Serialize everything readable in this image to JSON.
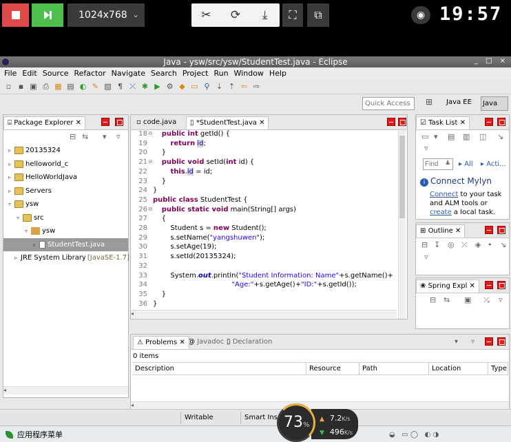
{
  "remote": {
    "resolution": "1024x768",
    "clock": "19:57"
  },
  "window": {
    "title": "Java - ysw/src/ysw/StudentTest.java - Eclipse"
  },
  "menu": [
    "File",
    "Edit",
    "Source",
    "Refactor",
    "Navigate",
    "Search",
    "Project",
    "Run",
    "Window",
    "Help"
  ],
  "toolbar": {
    "quick_access_placeholder": "Quick Access",
    "perspective_javaee": "Java EE",
    "perspective_java": "Java"
  },
  "package_explorer": {
    "title": "Package Explorer",
    "items": [
      {
        "label": "20135324",
        "depth": 0,
        "expanded": false,
        "icon": "project-folder"
      },
      {
        "label": "helloworld_c",
        "depth": 0,
        "expanded": false,
        "icon": "project-folder"
      },
      {
        "label": "HelloWorldJava",
        "depth": 0,
        "expanded": false,
        "icon": "project-folder"
      },
      {
        "label": "Servers",
        "depth": 0,
        "expanded": false,
        "icon": "project-folder"
      },
      {
        "label": "ysw",
        "depth": 0,
        "expanded": true,
        "icon": "project-folder"
      },
      {
        "label": "src",
        "depth": 1,
        "expanded": true,
        "icon": "source-folder"
      },
      {
        "label": "ysw",
        "depth": 2,
        "expanded": true,
        "icon": "package"
      },
      {
        "label": "StudentTest.java",
        "depth": 3,
        "expanded": false,
        "icon": "java-file",
        "selected": true
      },
      {
        "label": "JRE System Library",
        "suffix": "[JavaSE-1.7]",
        "depth": 1,
        "expanded": false,
        "icon": "library"
      }
    ]
  },
  "editor": {
    "tabs": [
      {
        "label": "code.java",
        "active": false
      },
      {
        "label": "*StudentTest.java",
        "active": true
      }
    ],
    "lines": [
      {
        "n": "18",
        "fold": "⊖",
        "html": "    <span class=\"kw\">public int</span> getId() {"
      },
      {
        "n": "19",
        "fold": "",
        "html": "        <span class=\"kw\">return</span> <span class=\"fld hl\">id</span>;"
      },
      {
        "n": "20",
        "fold": "",
        "html": "    }"
      },
      {
        "n": "21",
        "fold": "⊖",
        "html": "    <span class=\"kw\">public void</span> setId(<span class=\"kw\">int</span> id) {"
      },
      {
        "n": "22",
        "fold": "",
        "html": "        <span class=\"kw\">this</span>.<span class=\"fld hl\">id</span> = id;"
      },
      {
        "n": "23",
        "fold": "",
        "html": "    }"
      },
      {
        "n": "24",
        "fold": "",
        "html": "}"
      },
      {
        "n": "25",
        "fold": "",
        "html": "<span class=\"kw\">public class</span> StudentTest {"
      },
      {
        "n": "26",
        "fold": "⊖",
        "html": "    <span class=\"kw\">public static void</span> main(String[] args)"
      },
      {
        "n": "27",
        "fold": "",
        "html": "    {"
      },
      {
        "n": "28",
        "fold": "",
        "html": "        Student s = <span class=\"kw\">new</span> Student();"
      },
      {
        "n": "29",
        "fold": "",
        "html": "        s.setName(<span class=\"str\">\"yangshuwen\"</span>);"
      },
      {
        "n": "30",
        "fold": "",
        "html": "        s.setAge(19);"
      },
      {
        "n": "31",
        "fold": "",
        "html": "        s.setId(20135324);"
      },
      {
        "n": "32",
        "fold": "",
        "html": ""
      },
      {
        "n": "33",
        "fold": "",
        "html": "        System.<span class=\"sta\">out</span>.println(<span class=\"str\">\"Student Information: Name\"</span>+s.getName()+"
      },
      {
        "n": "34",
        "fold": "",
        "html": "                                    <span class=\"str\">\"Age:\"</span>+s.getAge()+<span class=\"str\">\"ID:\"</span>+s.getId());"
      },
      {
        "n": "35",
        "fold": "",
        "html": "    }"
      },
      {
        "n": "36",
        "fold": "",
        "html": "}"
      },
      {
        "n": "37",
        "fold": "",
        "html": ""
      }
    ]
  },
  "task_list": {
    "title": "Task List",
    "find_placeholder": "Find",
    "all_label": "All",
    "activate_label": "Acti...",
    "mylyn_title": "Connect Mylyn",
    "mylyn_connect": "Connect",
    "mylyn_text1": " to your task and ALM tools or ",
    "mylyn_create": "create",
    "mylyn_text2": " a local task."
  },
  "outline": {
    "title": "Outline"
  },
  "spring": {
    "title": "Spring Expl"
  },
  "problems": {
    "tabs": [
      {
        "label": "Problems",
        "active": true
      },
      {
        "label": "Javadoc",
        "active": false
      },
      {
        "label": "Declaration",
        "active": false
      }
    ],
    "count": "0 items",
    "columns": [
      "Description",
      "Resource",
      "Path",
      "Location",
      "Type"
    ]
  },
  "status": {
    "writable": "Writable",
    "insert_mode": "Smart Inse"
  },
  "taskbar": {
    "start_menu": "应用程序菜单"
  },
  "net_gauge": {
    "cpu_percent": "73",
    "cpu_unit": "%",
    "up_value": "7.2",
    "up_unit": "K/s",
    "down_value": "496",
    "down_unit": "K/s"
  }
}
